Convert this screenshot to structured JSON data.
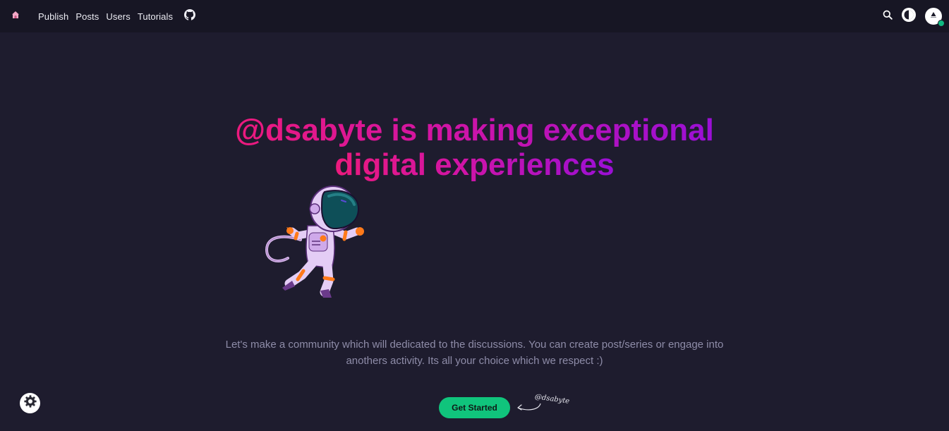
{
  "nav": {
    "home_icon": "home-icon",
    "links": [
      {
        "label": "Publish"
      },
      {
        "label": "Posts"
      },
      {
        "label": "Users"
      },
      {
        "label": "Tutorials"
      }
    ],
    "github_icon": "github-icon",
    "search_icon": "search-icon",
    "theme_icon": "theme-toggle-icon",
    "avatar_icon": "user-avatar-icon",
    "status_color": "#10b981"
  },
  "hero": {
    "title_line1": "@dsabyte is making exceptional",
    "title_line2": "digital experiences",
    "subtitle": "Let's make a community which will dedicated to the discussions. You can create post/series or engage into anothers activity. Its all your choice which we respect :)",
    "cta_label": "Get Started",
    "signature": "@dsabyte",
    "gradient_start": "#ec1a7d",
    "gradient_end": "#9a0fd6",
    "cta_color": "#10c47c"
  },
  "settings": {
    "icon": "gear-icon"
  }
}
